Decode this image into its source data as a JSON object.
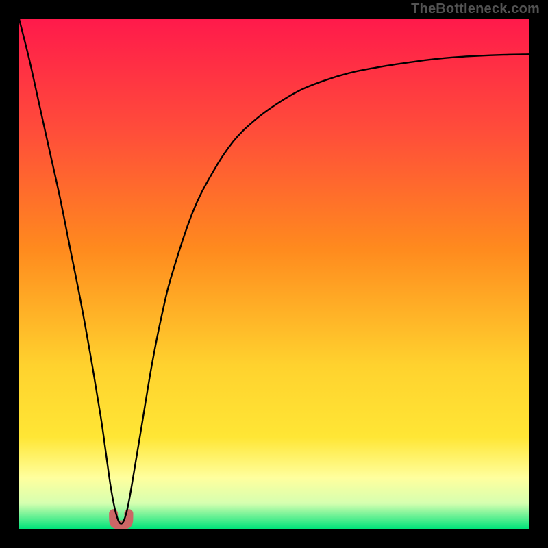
{
  "watermark": "TheBottleneck.com",
  "colors": {
    "black": "#000000",
    "red_top": "#ff1a4b",
    "orange": "#ff8a1e",
    "yellow": "#ffe635",
    "pale_yellow": "#ffff9e",
    "green_bottom": "#00e37a",
    "curve_stroke": "#000000",
    "accent": "#cc6666"
  },
  "chart_data": {
    "type": "line",
    "title": "",
    "xlabel": "",
    "ylabel": "",
    "xlim": [
      0,
      100
    ],
    "ylim": [
      0,
      100
    ],
    "x": [
      0,
      2,
      4,
      6,
      8,
      10,
      12,
      14,
      16,
      17,
      18,
      19,
      20,
      21,
      22,
      24,
      26,
      28,
      30,
      34,
      38,
      42,
      46,
      50,
      55,
      60,
      65,
      70,
      75,
      80,
      85,
      90,
      95,
      100
    ],
    "values": [
      100,
      92,
      83,
      74,
      65,
      55,
      45,
      34,
      22,
      15,
      8,
      3,
      1,
      3,
      8,
      20,
      32,
      42,
      50,
      62,
      70,
      76,
      80,
      83,
      86,
      88,
      89.5,
      90.5,
      91.3,
      92,
      92.5,
      92.8,
      93,
      93.1
    ],
    "accent_region_x": [
      18.5,
      21.5
    ],
    "accent_region_y": [
      0,
      3
    ]
  }
}
